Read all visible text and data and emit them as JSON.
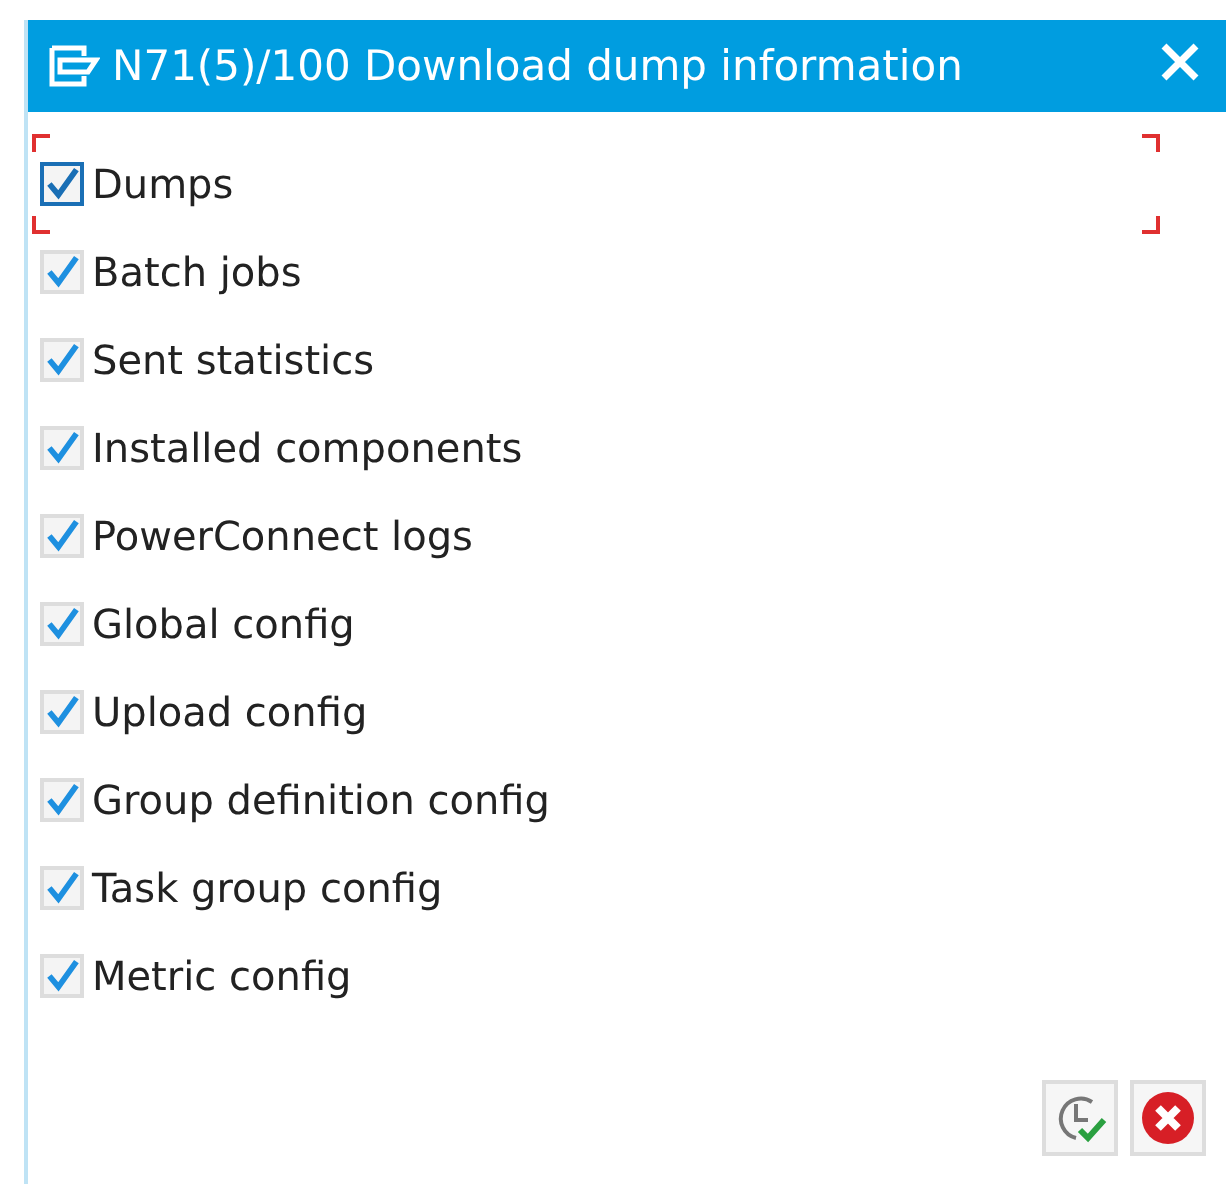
{
  "window": {
    "title": "N71(5)/100 Download dump information"
  },
  "options": [
    {
      "label": "Dumps",
      "checked": true,
      "focused": true
    },
    {
      "label": "Batch jobs",
      "checked": true,
      "focused": false
    },
    {
      "label": "Sent statistics",
      "checked": true,
      "focused": false
    },
    {
      "label": "Installed components",
      "checked": true,
      "focused": false
    },
    {
      "label": "PowerConnect logs",
      "checked": true,
      "focused": false
    },
    {
      "label": "Global config",
      "checked": true,
      "focused": false
    },
    {
      "label": "Upload config",
      "checked": true,
      "focused": false
    },
    {
      "label": "Group definition config",
      "checked": true,
      "focused": false
    },
    {
      "label": "Task group config",
      "checked": true,
      "focused": false
    },
    {
      "label": "Metric config",
      "checked": true,
      "focused": false
    }
  ],
  "buttons": [
    {
      "kind": "execute"
    },
    {
      "kind": "cancel"
    }
  ]
}
